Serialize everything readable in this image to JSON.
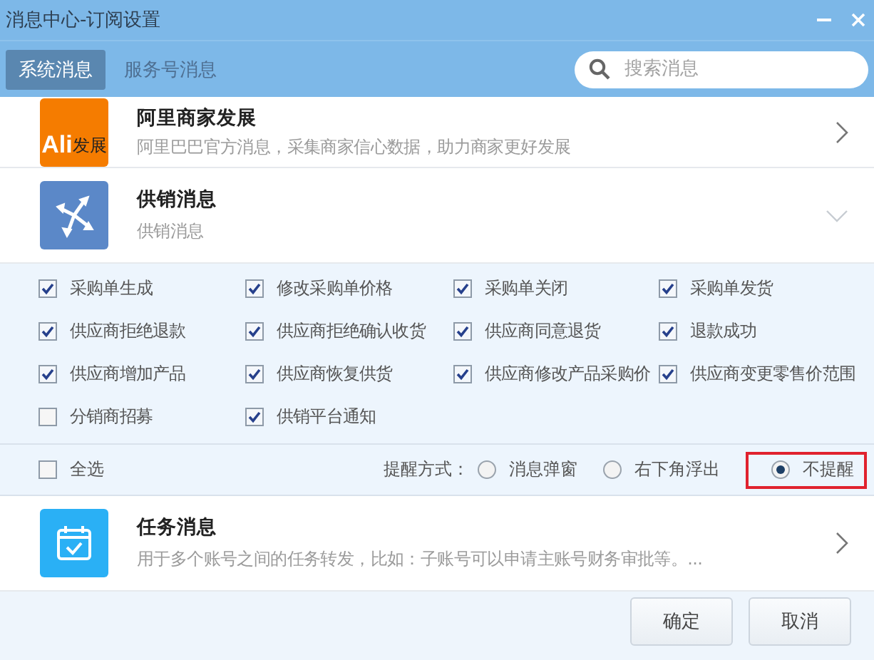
{
  "window": {
    "title": "消息中心-订阅设置"
  },
  "tabs": [
    {
      "label": "系统消息",
      "selected": true
    },
    {
      "label": "服务号消息",
      "selected": false
    }
  ],
  "search": {
    "placeholder": "搜索消息"
  },
  "subscriptions": [
    {
      "kind": "ali",
      "logo": [
        "Ali",
        "发展"
      ],
      "title": "阿里商家发展",
      "description": "阿里巴巴官方消息，采集商家信心数据，助力商家更好发展",
      "expanded": false
    },
    {
      "kind": "supply",
      "title": "供销消息",
      "description": "供销消息",
      "expanded": true
    },
    {
      "kind": "task",
      "title": "任务消息",
      "description": "用于多个账号之间的任务转发，比如：子账号可以申请主账号财务审批等。...",
      "expanded": false
    }
  ],
  "options": [
    {
      "label": "采购单生成",
      "checked": true
    },
    {
      "label": "修改采购单价格",
      "checked": true
    },
    {
      "label": "采购单关闭",
      "checked": true
    },
    {
      "label": "采购单发货",
      "checked": true
    },
    {
      "label": "供应商拒绝退款",
      "checked": true
    },
    {
      "label": "供应商拒绝确认收货",
      "checked": true
    },
    {
      "label": "供应商同意退货",
      "checked": true
    },
    {
      "label": "退款成功",
      "checked": true
    },
    {
      "label": "供应商增加产品",
      "checked": true
    },
    {
      "label": "供应商恢复供货",
      "checked": true
    },
    {
      "label": "供应商修改产品采购价",
      "checked": true
    },
    {
      "label": "供应商变更零售价范围",
      "checked": true
    },
    {
      "label": "分销商招募",
      "checked": false
    },
    {
      "label": "供销平台通知",
      "checked": true
    }
  ],
  "select_all": {
    "label": "全选",
    "checked": false
  },
  "reminder": {
    "label": "提醒方式：",
    "choices": [
      {
        "label": "消息弹窗",
        "selected": false,
        "highlighted": false
      },
      {
        "label": "右下角浮出",
        "selected": false,
        "highlighted": false
      },
      {
        "label": "不提醒",
        "selected": true,
        "highlighted": true
      }
    ]
  },
  "buttons": [
    "确定",
    "取消"
  ]
}
